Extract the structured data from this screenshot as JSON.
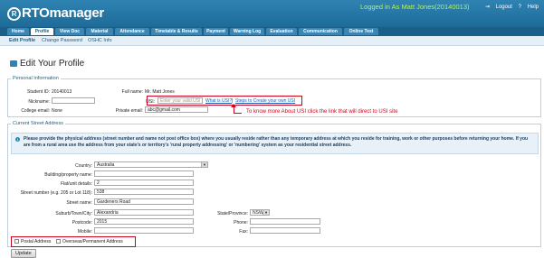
{
  "header": {
    "logo_text": "RTOmanager",
    "logged_in_text": "Logged in As Matt Jones(20140013)",
    "logout_label": "Logout",
    "help_label": "Help"
  },
  "nav": [
    "Home",
    "Profile",
    "View Doc",
    "Material",
    "Attendance",
    "Timetable & Results",
    "Payment",
    "Warning Log",
    "Evaluation",
    "Communication",
    "Online Test"
  ],
  "subnav": [
    "Edit Profile",
    "Change Password",
    "OSHC Info"
  ],
  "page": {
    "title": "Edit Your Profile"
  },
  "personal": {
    "legend": "Personal Information",
    "student_id_label": "Student ID:",
    "student_id": "20140013",
    "nickname_label": "Nickname:",
    "nickname": "",
    "college_email_label": "College email:",
    "college_email": "None",
    "full_name_label": "Full name:",
    "full_name": "Mr. Matt Jones",
    "usi_label": "USI:",
    "usi_placeholder": "Enter your valid USI here",
    "what_is_usi": "What is USI?",
    "create_usi": "Steps to Create your own USI",
    "private_email_label": "Private email:",
    "private_email": "abc@gmail.com"
  },
  "annotation": "To know more About USI click the link that will direct to USI site",
  "address": {
    "legend": "Current Street Address",
    "info": "Please provide the physical address (street number and name not post office box) where you usually reside rather than any temporary address at which you reside for training, work or other purposes before returning your home. If you are from a rural area use the address from your state's or territory's 'rural property addressing' or 'numbering' system as your residential street address.",
    "country_label": "Country:",
    "country": "Australia",
    "building_label": "Building/property name:",
    "building": "",
    "flat_label": "Flat/unit details:",
    "flat": "2",
    "street_number_label": "Street number (e.g. 205 or Lot 118):",
    "street_number": "538",
    "street_name_label": "Street name:",
    "street_name": "Gardeners Road",
    "suburb_label": "Suburb/Town/City:",
    "suburb": "Alexandria",
    "state_label": "State/Province:",
    "state": "NSW",
    "postcode_label": "Postcode:",
    "postcode": "2015",
    "phone_label": "Phone:",
    "phone": "",
    "mobile_label": "Mobile:",
    "mobile": "",
    "fax_label": "Fax:",
    "fax": "",
    "postal_label": "Postal Address",
    "overseas_label": "Overseas/Permanent Address"
  },
  "update_button": "Update"
}
